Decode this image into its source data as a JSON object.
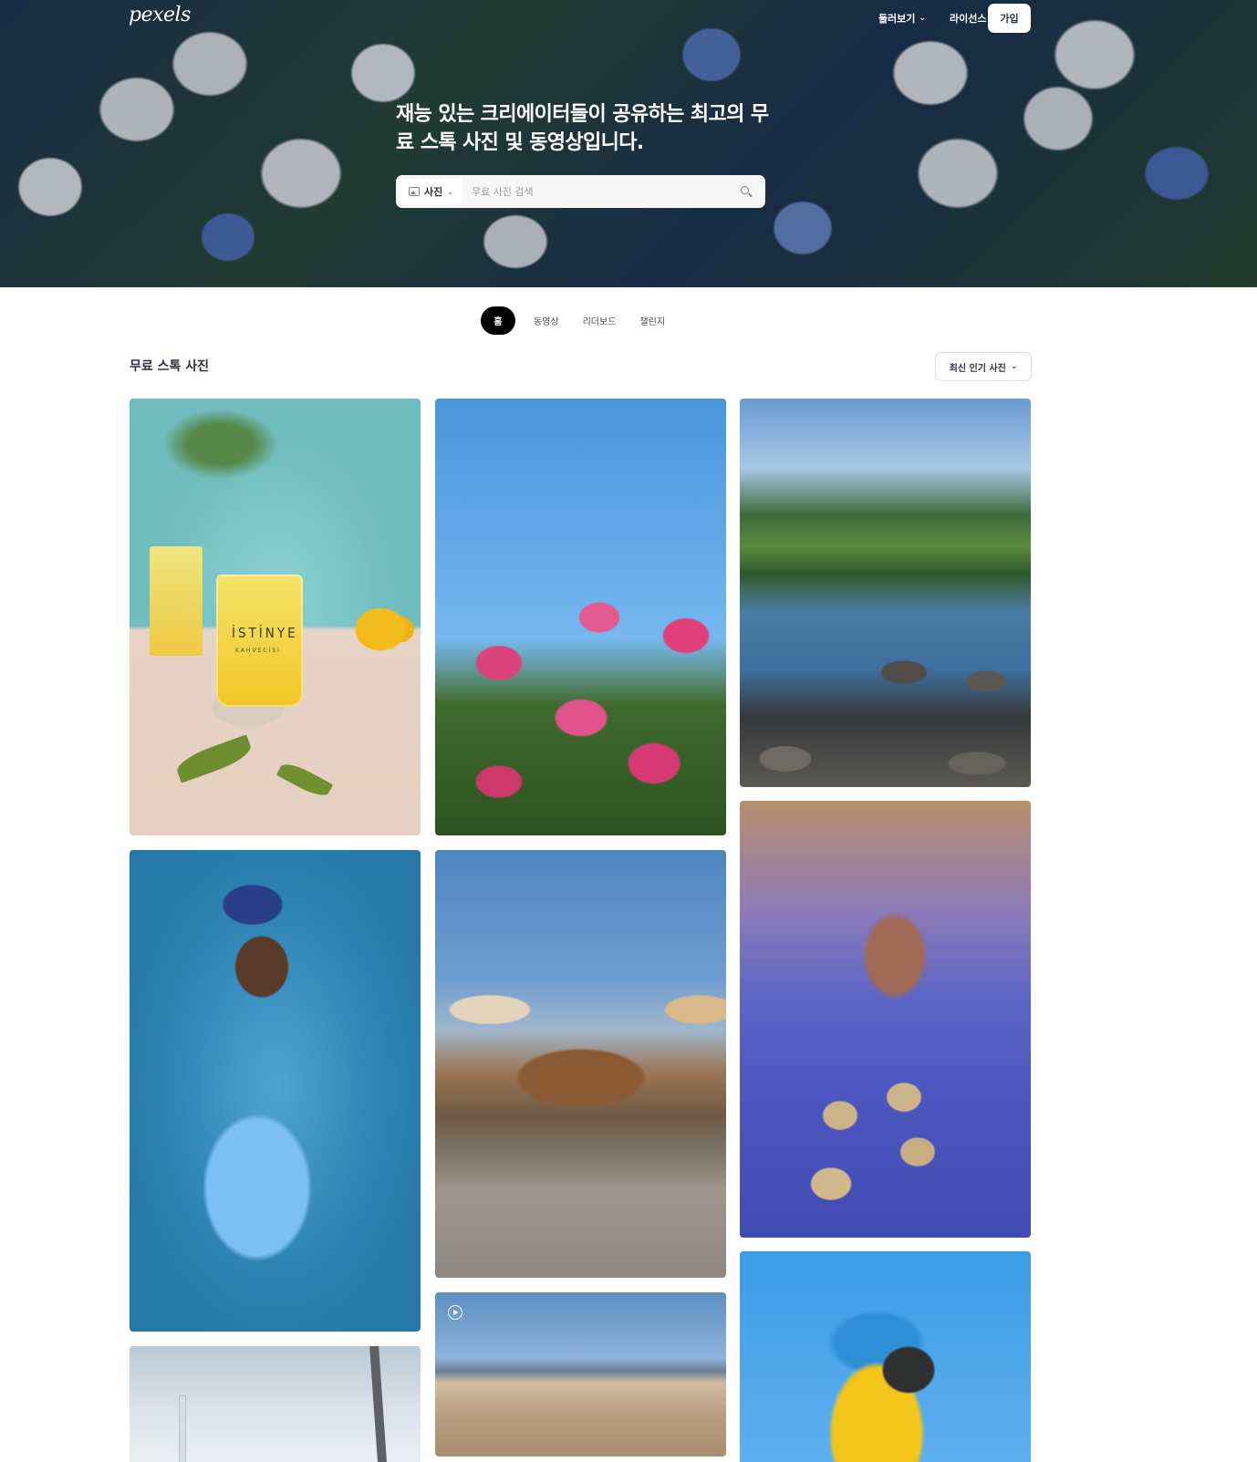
{
  "header": {
    "logo": "pexels",
    "nav": [
      {
        "label": "둘러보기",
        "has_dropdown": true
      },
      {
        "label": "라이선스",
        "has_dropdown": false
      }
    ],
    "more_label": "···",
    "join_label": "가입"
  },
  "hero": {
    "title": "재능 있는 크리에이터들이 공유하는 최고의 무료 스톡 사진 및 동영상입니다.",
    "search": {
      "type_label": "사진",
      "placeholder": "무료 사진 검색",
      "value": ""
    }
  },
  "tabs": [
    {
      "label": "홈",
      "active": true
    },
    {
      "label": "동영상",
      "active": false
    },
    {
      "label": "리더보드",
      "active": false
    },
    {
      "label": "챌린지",
      "active": false
    }
  ],
  "section": {
    "title": "무료 스톡 사진",
    "sort_label": "최신 인기 사진"
  },
  "photos": [
    {
      "subject": "lemonade",
      "cup_brand": "İSTİNYE",
      "cup_sub": "KAHVECİSİ"
    },
    {
      "subject": "oleander"
    },
    {
      "subject": "mountain-lake"
    },
    {
      "subject": "portrait"
    },
    {
      "subject": "beach-cafe"
    },
    {
      "subject": "blue-stairs"
    },
    {
      "subject": "tower"
    },
    {
      "subject": "beach-video",
      "is_video": true
    },
    {
      "subject": "macaw"
    }
  ],
  "colors": {
    "accent": "#000000",
    "text": "#2c343e",
    "button_bg": "#ffffff"
  }
}
